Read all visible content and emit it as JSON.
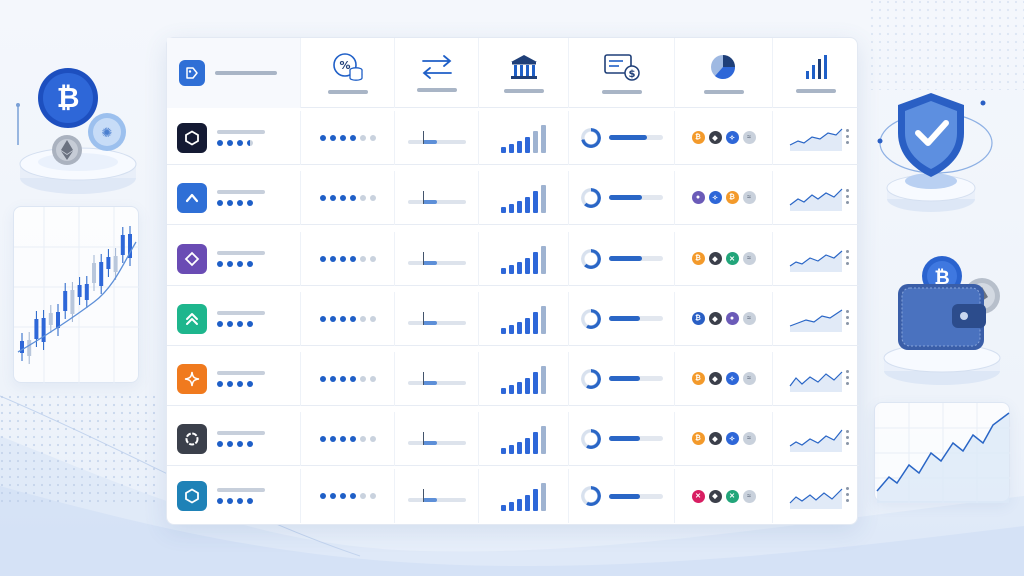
{
  "colors": {
    "accent": "#1f5fc7",
    "accent_light": "#5d8fd8",
    "muted": "#c9d2de",
    "bitcoin": "#f39a2b",
    "ethereum": "#3b3f4a",
    "shield": "#2a5fc4"
  },
  "header": {
    "columns": [
      {
        "icon": "tag-icon"
      },
      {
        "icon": "percent-coins-icon"
      },
      {
        "icon": "exchange-arrows-icon"
      },
      {
        "icon": "bank-icon"
      },
      {
        "icon": "payment-card-dollar-icon"
      },
      {
        "icon": "pie-chart-icon"
      },
      {
        "icon": "bar-chart-icon"
      }
    ]
  },
  "rows": [
    {
      "logo_icon": "hexagon-icon",
      "logo_color": "#141a33",
      "rating": 4,
      "rating_half": true,
      "score": 4,
      "level": 0.25,
      "volume_bars": 6,
      "progress": 0.72,
      "coins": [
        "bitcoin",
        "ethereum",
        "cardano",
        "stellar"
      ]
    },
    {
      "logo_icon": "chevron-up-icon",
      "logo_color": "#2f6fd6",
      "rating": 4,
      "rating_half": false,
      "score": 4,
      "level": 0.25,
      "volume_bars": 6,
      "progress": 0.62,
      "coins": [
        "polkadot",
        "cardano",
        "bitcoin",
        "stellar"
      ]
    },
    {
      "logo_icon": "diamond-icon",
      "logo_color": "#6a4cb4",
      "rating": 4,
      "rating_half": false,
      "score": 4,
      "level": 0.25,
      "volume_bars": 6,
      "progress": 0.62,
      "coins": [
        "bitcoin",
        "ethereum",
        "tether",
        "stellar"
      ]
    },
    {
      "logo_icon": "double-chevron-up-icon",
      "logo_color": "#1eb68d",
      "rating": 4,
      "rating_half": false,
      "score": 4,
      "level": 0.25,
      "volume_bars": 6,
      "progress": 0.58,
      "coins": [
        "bitcoin-blue",
        "ethereum",
        "polkadot",
        "stellar"
      ]
    },
    {
      "logo_icon": "sparkle-icon",
      "logo_color": "#f07a1e",
      "rating": 4,
      "rating_half": false,
      "score": 4,
      "level": 0.25,
      "volume_bars": 6,
      "progress": 0.58,
      "coins": [
        "bitcoin",
        "ethereum",
        "cardano",
        "stellar"
      ]
    },
    {
      "logo_icon": "circle-icon",
      "logo_color": "#3b404b",
      "rating": 4,
      "rating_half": false,
      "score": 4,
      "level": 0.25,
      "volume_bars": 6,
      "progress": 0.58,
      "coins": [
        "bitcoin",
        "ethereum",
        "cardano",
        "stellar"
      ]
    },
    {
      "logo_icon": "hexagon-icon",
      "logo_color": "#1f82b7",
      "rating": 4,
      "rating_half": false,
      "score": 4,
      "level": 0.25,
      "volume_bars": 6,
      "progress": 0.58,
      "coins": [
        "ripple",
        "ethereum",
        "tether",
        "stellar"
      ]
    }
  ],
  "decorations": {
    "left_top": "bitcoin-coins-pedestal",
    "left_chart": "candlestick-chart",
    "right_top": "security-shield-pedestal",
    "right_mid": "crypto-wallet-pedestal",
    "right_chart": "line-chart"
  }
}
